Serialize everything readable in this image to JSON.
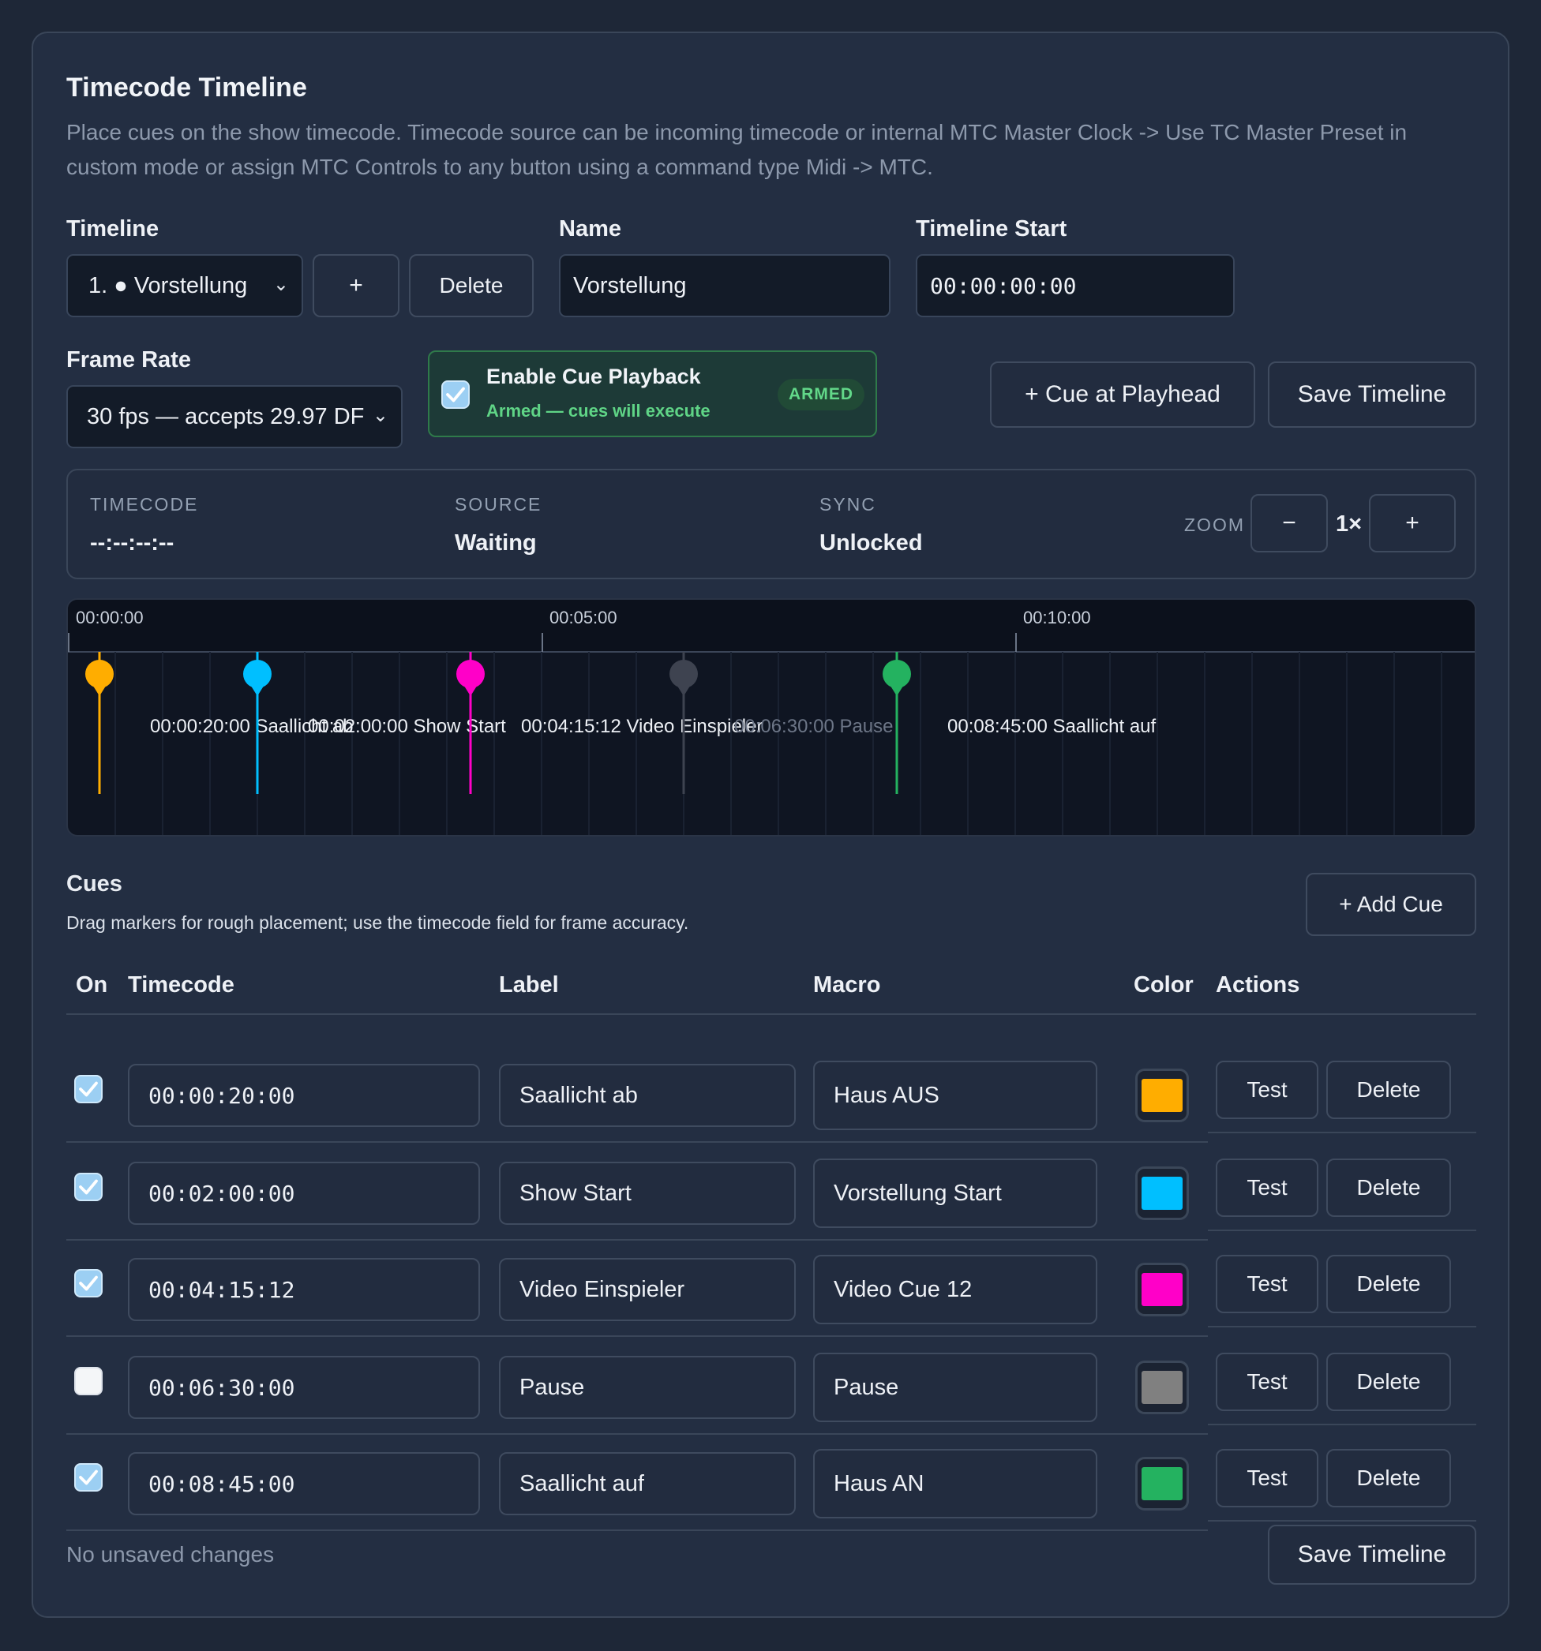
{
  "panel": {
    "title": "Timecode Timeline",
    "description": "Place cues on the show timecode. Timecode source can be incoming timecode or internal MTC Master Clock -> Use TC Master Preset in custom mode or assign MTC Controls to any button using a command type Midi -> MTC."
  },
  "timeline_field": {
    "label": "Timeline",
    "selected": "1. ● Vorstellung",
    "add_label": "+",
    "delete_label": "Delete"
  },
  "name_field": {
    "label": "Name",
    "value": "Vorstellung"
  },
  "start_field": {
    "label": "Timeline Start",
    "value": "00:00:00:00"
  },
  "frame_rate": {
    "label": "Frame Rate",
    "selected": "30 fps — accepts 29.97 DF"
  },
  "enable_playback": {
    "label": "Enable Cue Playback",
    "status": "Armed — cues will execute",
    "badge": "ARMED",
    "checked": true
  },
  "actions": {
    "cue_at_playhead": "+ Cue at Playhead",
    "save_timeline": "Save Timeline"
  },
  "status_bar": {
    "timecode_label": "TIMECODE",
    "timecode_value": "--:--:--:--",
    "source_label": "SOURCE",
    "source_value": "Waiting",
    "sync_label": "SYNC",
    "sync_value": "Unlocked",
    "zoom_label": "ZOOM",
    "zoom_minus": "−",
    "zoom_value": "1×",
    "zoom_plus": "+"
  },
  "ruler": {
    "ticks": [
      "00:00:00",
      "00:05:00",
      "00:10:00"
    ]
  },
  "markers": [
    {
      "label": "00:00:20:00 Saallicht ab",
      "color": "#ffad00",
      "enabled": true
    },
    {
      "label": "00:02:00:00 Show Start",
      "color": "#00bfff",
      "enabled": true
    },
    {
      "label": "00:04:15:12 Video Einspieler",
      "color": "#ff00c8",
      "enabled": true
    },
    {
      "label": "00:06:30:00 Pause",
      "color": "#3e4350",
      "enabled": false
    },
    {
      "label": "00:08:45:00 Saallicht auf",
      "color": "#24b260",
      "enabled": true
    }
  ],
  "cues_section": {
    "title": "Cues",
    "subtitle": "Drag markers for rough placement; use the timecode field for frame accuracy.",
    "add_label": "+ Add Cue",
    "headers": {
      "on": "On",
      "timecode": "Timecode",
      "label": "Label",
      "macro": "Macro",
      "color": "Color",
      "actions": "Actions"
    },
    "test_label": "Test",
    "delete_label": "Delete",
    "rows": [
      {
        "on": true,
        "timecode": "00:00:20:00",
        "label": "Saallicht ab",
        "macro": "Haus AUS",
        "color": "#ffad00"
      },
      {
        "on": true,
        "timecode": "00:02:00:00",
        "label": "Show Start",
        "macro": "Vorstellung Start",
        "color": "#00bfff"
      },
      {
        "on": true,
        "timecode": "00:04:15:12",
        "label": "Video Einspieler",
        "macro": "Video Cue 12",
        "color": "#ff00c8"
      },
      {
        "on": false,
        "timecode": "00:06:30:00",
        "label": "Pause",
        "macro": "Pause",
        "color": "#808080"
      },
      {
        "on": true,
        "timecode": "00:08:45:00",
        "label": "Saallicht auf",
        "macro": "Haus AN",
        "color": "#24b260"
      }
    ]
  },
  "footer": {
    "status": "No unsaved changes",
    "save_label": "Save Timeline"
  }
}
